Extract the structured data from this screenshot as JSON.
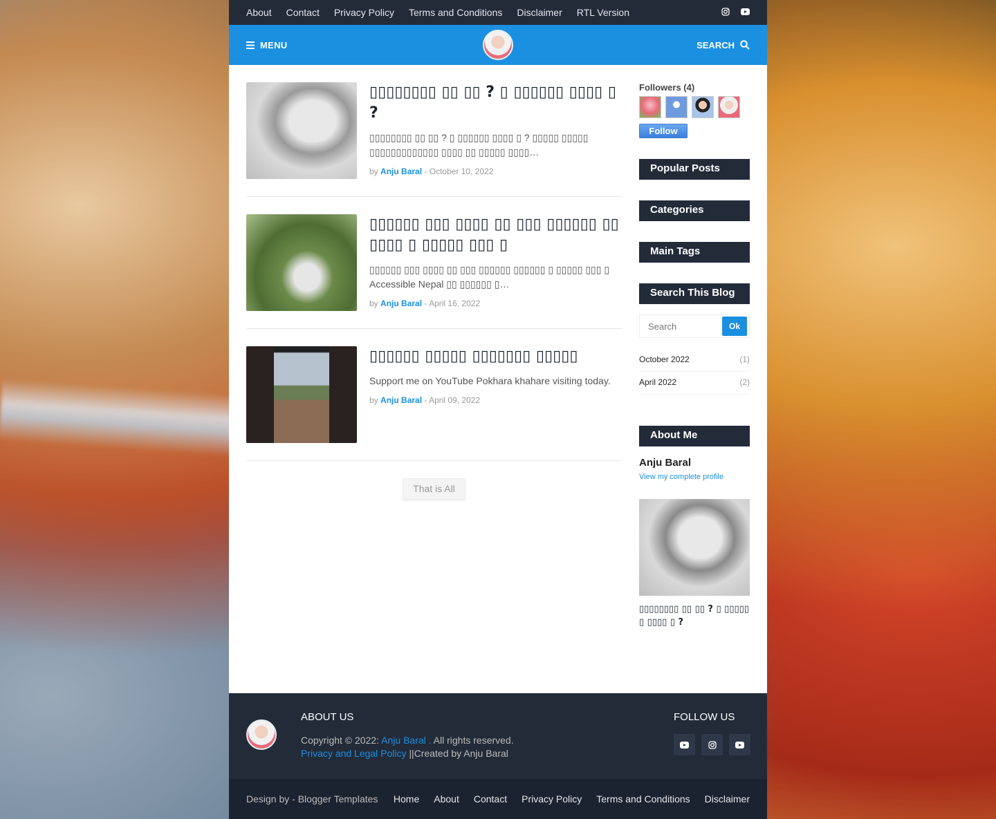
{
  "topbar": {
    "links": [
      "About",
      "Contact",
      "Privacy Policy",
      "Terms and Conditions",
      "Disclaimer",
      "RTL Version"
    ]
  },
  "nav": {
    "menu_label": "MENU",
    "search_label": "SEARCH"
  },
  "posts": [
    {
      "title": "▯▯▯▯▯▯▯▯ ▯▯ ▯▯ ? ▯ ▯▯▯▯▯▯ ▯▯▯▯ ▯ ?",
      "excerpt": "▯▯▯▯▯▯▯▯ ▯▯ ▯▯ ? ▯ ▯▯▯▯▯▯ ▯▯▯▯ ▯ ?  ▯▯▯▯▯ ▯▯▯▯▯ ▯▯▯▯▯▯▯▯▯▯▯▯▯ ▯▯▯▯ ▯▯ ▯▯▯▯▯ ▯▯▯▯…",
      "by": "by",
      "author": "Anju Baral",
      "sep": "-",
      "date": "October 10, 2022"
    },
    {
      "title": "▯▯▯▯▯▯ ▯▯▯ ▯▯▯▯ ▯▯ ▯▯▯ ▯▯▯▯▯▯ ▯▯▯▯▯▯ ▯ ▯▯▯▯▯ ▯▯▯ ▯",
      "excerpt": "▯▯▯▯▯▯ ▯▯▯ ▯▯▯▯ ▯▯ ▯▯▯ ▯▯▯▯▯▯ ▯▯▯▯▯▯ ▯ ▯▯▯▯▯ ▯▯▯ ▯ Accessible Nepal ▯▯ ▯▯▯▯▯▯ ▯…",
      "by": "by",
      "author": "Anju Baral",
      "sep": "-",
      "date": "April 16, 2022"
    },
    {
      "title": "▯▯▯▯▯▯ ▯▯▯▯▯ ▯▯▯▯▯▯▯ ▯▯▯▯▯",
      "excerpt": "Support me on YouTube Pokhara khahare visiting today.",
      "by": "by",
      "author": "Anju Baral",
      "sep": "-",
      "date": "April 09, 2022"
    }
  ],
  "that_is_all": "That is All",
  "sidebar": {
    "followers_title": "Followers (4)",
    "follow_button": "Follow",
    "popular_title": "Popular Posts",
    "categories_title": "Categories",
    "tags_title": "Main Tags",
    "search_title": "Search This Blog",
    "search_placeholder": "Search",
    "search_button": "Ok",
    "archive": [
      {
        "month": "October 2022",
        "count": "(1)"
      },
      {
        "month": "April 2022",
        "count": "(2)"
      }
    ],
    "about_title": "About Me",
    "about_name": "Anju Baral",
    "about_link": "View my complete profile",
    "featured_title": "▯▯▯▯▯▯▯▯ ▯▯ ▯▯ ? ▯ ▯▯▯▯▯▯ ▯▯▯▯ ▯ ?"
  },
  "footer": {
    "about_title": "ABOUT US",
    "copyright_prefix": "Copyright © 2022:",
    "copyright_name": "Anju Baral .",
    "copyright_suffix": "All rights reserved.",
    "policy_link": "Privacy and Legal Policy",
    "created_by": "||Created by Anju Baral",
    "follow_title": "FOLLOW US"
  },
  "bottombar": {
    "design_prefix": "Design by -",
    "design_link": "Blogger Templates",
    "links": [
      "Home",
      "About",
      "Contact",
      "Privacy Policy",
      "Terms and Conditions",
      "Disclaimer"
    ]
  }
}
